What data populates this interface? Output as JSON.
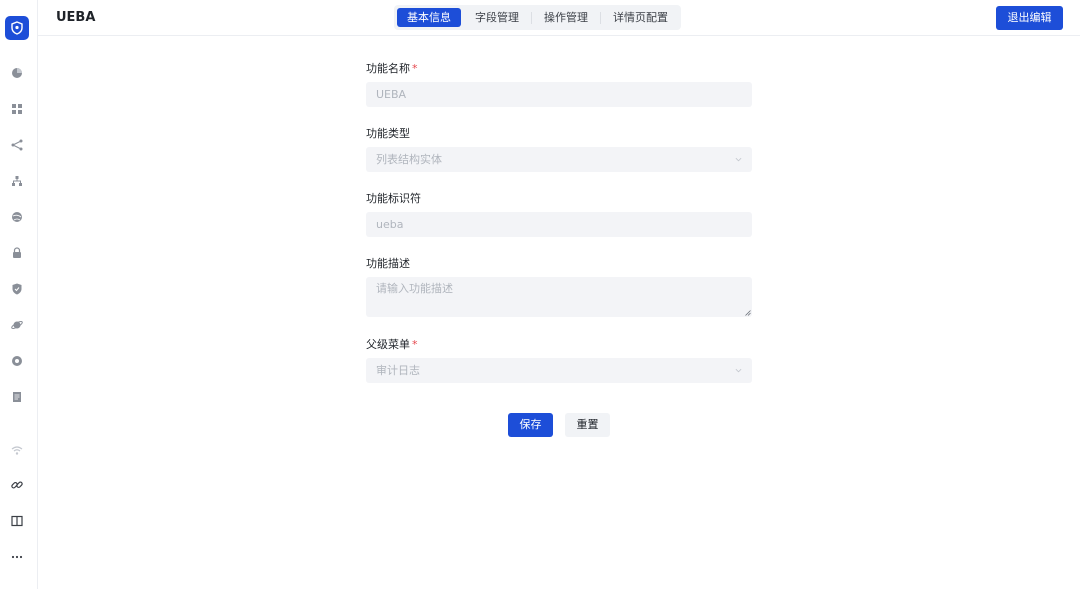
{
  "app": {
    "title": "UEBA"
  },
  "tabs": [
    {
      "label": "基本信息",
      "active": true
    },
    {
      "label": "字段管理",
      "active": false
    },
    {
      "label": "操作管理",
      "active": false
    },
    {
      "label": "详情页配置",
      "active": false
    }
  ],
  "header": {
    "exit_label": "退出编辑"
  },
  "sidebar": {
    "logo_icon": "shield-icon",
    "items": [
      "pie-chart-icon",
      "dashboard-icon",
      "share-icon",
      "hierarchy-icon",
      "globe-icon",
      "lock-icon",
      "shield-check-icon",
      "planet-icon",
      "badge-icon",
      "document-icon",
      "wifi-icon",
      "link-icon",
      "book-icon",
      "more-icon"
    ]
  },
  "form": {
    "name_label": "功能名称",
    "name_value": "UEBA",
    "type_label": "功能类型",
    "type_value": "列表结构实体",
    "identifier_label": "功能标识符",
    "identifier_value": "ueba",
    "description_label": "功能描述",
    "description_placeholder": "请输入功能描述",
    "parent_label": "父级菜单",
    "parent_value": "审计日志",
    "required_mark": "*"
  },
  "actions": {
    "save_label": "保存",
    "reset_label": "重置"
  },
  "colors": {
    "primary": "#1d4ed8",
    "required": "#e5484d",
    "field_bg": "#f3f4f7"
  }
}
